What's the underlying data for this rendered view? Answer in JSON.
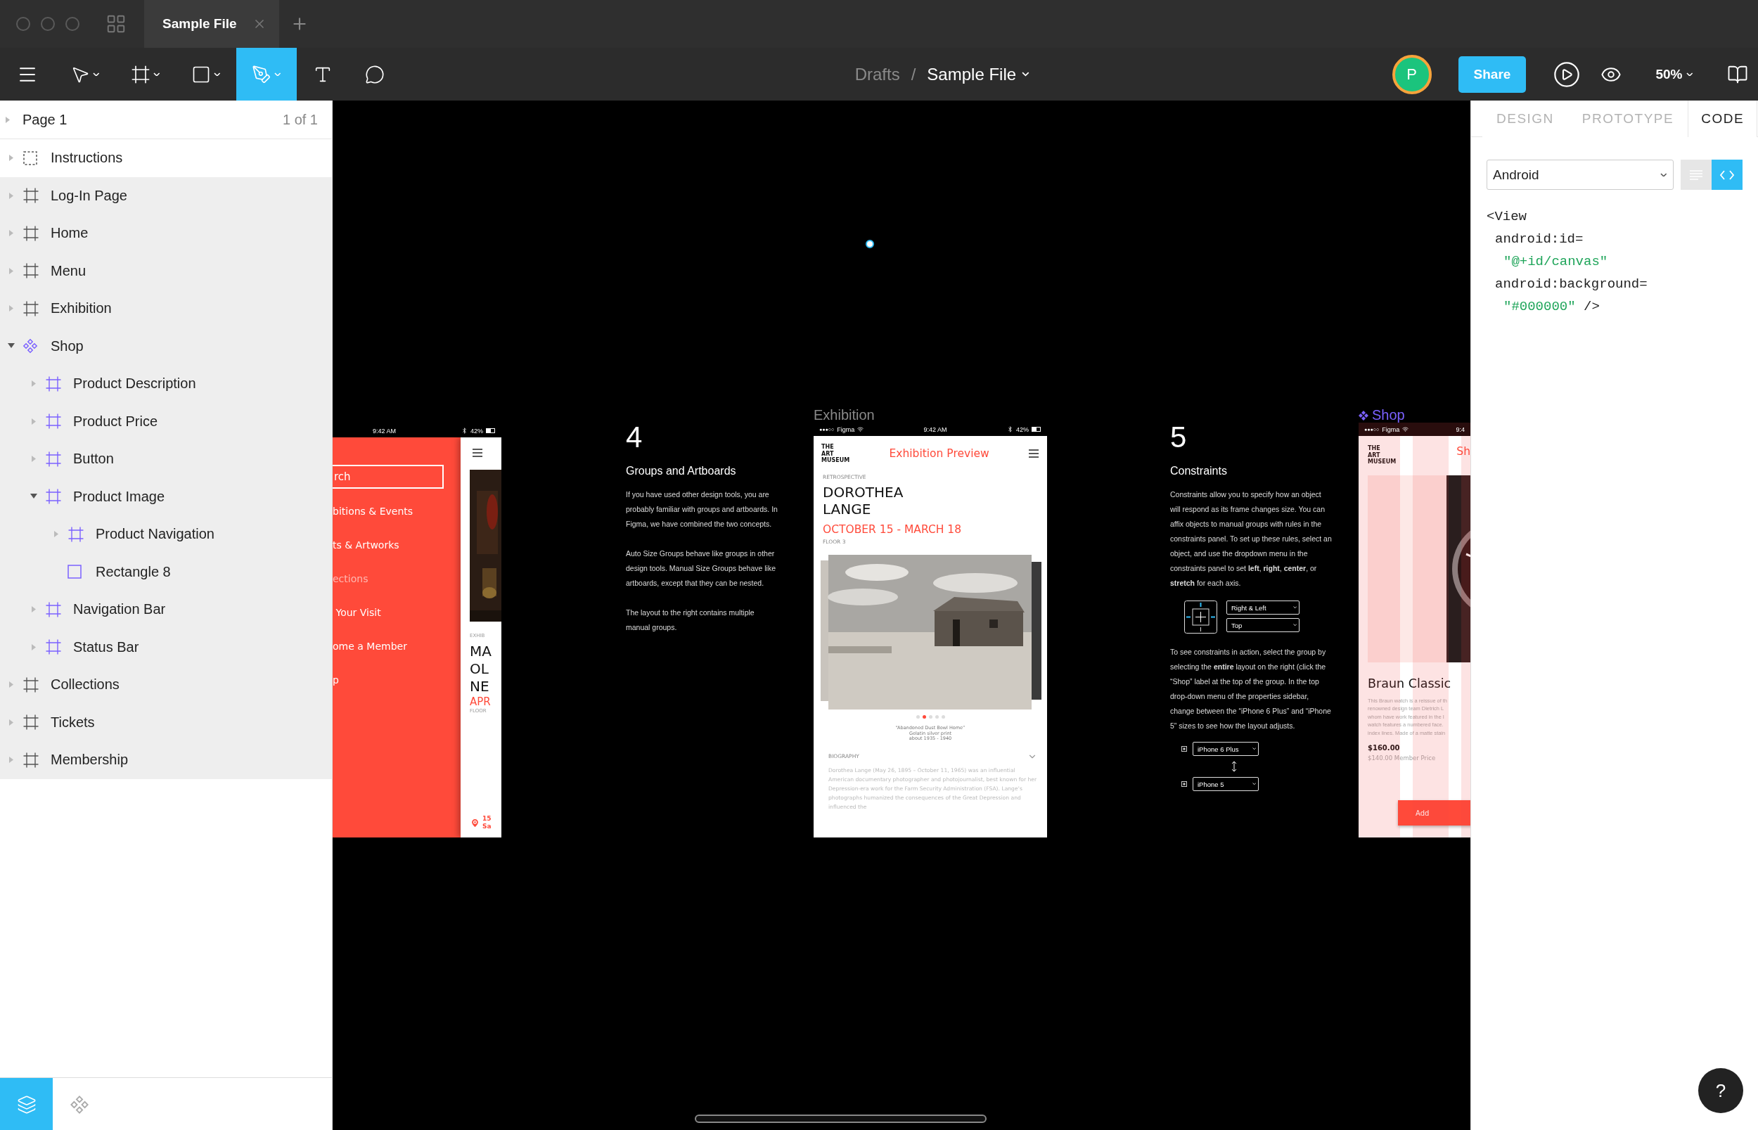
{
  "title_bar": {
    "tabs": [
      {
        "label": "Sample File",
        "selected": true
      }
    ]
  },
  "toolbar": {
    "tools": [
      {
        "kind": "move",
        "selected": false,
        "has_menu": true
      },
      {
        "kind": "frame",
        "selected": false,
        "has_menu": true
      },
      {
        "kind": "shape",
        "selected": false,
        "has_menu": true
      },
      {
        "kind": "pen",
        "selected": true,
        "has_menu": true
      },
      {
        "kind": "text",
        "selected": false,
        "has_menu": false
      },
      {
        "kind": "comment",
        "selected": false,
        "has_menu": false
      }
    ],
    "breadcrumb": {
      "folder": "Drafts",
      "separator": "/",
      "file": "Sample File"
    },
    "avatar": "P",
    "share": "Share",
    "zoom": "50%"
  },
  "layers": {
    "page": {
      "name": "Page 1",
      "count": "1 of 1"
    },
    "items": [
      {
        "name": "Instructions",
        "kind": "group",
        "highlighted": false,
        "expanded": false
      },
      {
        "name": "Log-In Page",
        "kind": "frame",
        "highlighted": true,
        "expanded": false
      },
      {
        "name": "Home",
        "kind": "frame",
        "highlighted": true,
        "expanded": false
      },
      {
        "name": "Menu",
        "kind": "frame",
        "highlighted": true,
        "expanded": false
      },
      {
        "name": "Exhibition",
        "kind": "frame",
        "highlighted": true,
        "expanded": false
      },
      {
        "name": "Shop",
        "kind": "component",
        "highlighted": true,
        "expanded": true,
        "children": [
          {
            "name": "Product Description",
            "kind": "frame",
            "expanded": false
          },
          {
            "name": "Product Price",
            "kind": "frame",
            "expanded": false
          },
          {
            "name": "Button",
            "kind": "frame",
            "expanded": false
          },
          {
            "name": "Product Image",
            "kind": "frame",
            "expanded": true,
            "children": [
              {
                "name": "Product Navigation",
                "kind": "frame",
                "expanded": false
              },
              {
                "name": "Rectangle 8",
                "kind": "rectangle"
              }
            ]
          },
          {
            "name": "Navigation Bar",
            "kind": "frame",
            "expanded": false
          },
          {
            "name": "Status Bar",
            "kind": "frame",
            "expanded": false
          }
        ]
      },
      {
        "name": "Collections",
        "kind": "frame",
        "highlighted": true,
        "expanded": false
      },
      {
        "name": "Tickets",
        "kind": "frame",
        "highlighted": true,
        "expanded": false
      },
      {
        "name": "Membership",
        "kind": "frame",
        "highlighted": true,
        "expanded": false
      }
    ],
    "bottom_tabs": [
      {
        "kind": "layers",
        "selected": true
      },
      {
        "kind": "components",
        "selected": false
      }
    ]
  },
  "canvas": {
    "menu_frame": {
      "time": "9:42 AM",
      "battery": "42%",
      "search": {
        "placeholder": "rch"
      },
      "items": [
        {
          "label": "bitions & Events",
          "dimmed": false
        },
        {
          "label": "ts & Artworks",
          "dimmed": false
        },
        {
          "label": "ections",
          "dimmed": true
        },
        {
          "label": " Your Visit",
          "dimmed": false
        },
        {
          "label": "ome a Member",
          "dimmed": false
        },
        {
          "label": "p",
          "dimmed": false
        }
      ],
      "side": {
        "tag": "EXHIB",
        "title_lines": [
          "MA",
          "OL",
          "NE"
        ],
        "date": "APR",
        "floor": "FLOOR",
        "address_lines": [
          "15",
          "Sa"
        ]
      }
    },
    "groups_note": {
      "number": "4",
      "title": "Groups and Artboards",
      "paragraphs": [
        "If you have used other design tools, you are probably familiar with groups and artboards. In Figma, we have combined the two concepts.",
        "Auto Size Groups behave like groups in other design tools. Manual Size Groups behave like artboards, except that they can be nested.",
        "The layout to the right contains multiple manual groups."
      ]
    },
    "exhibition_frame": {
      "label": "Exhibition",
      "signal": "●●●○○",
      "carrier": "Figma",
      "time": "9:42 AM",
      "battery": "42%",
      "logo": "THE\nART\nMUSEUM",
      "header": "Exhibition Preview",
      "eyebrow": "RETROSPECTIVE",
      "title": "DOROTHEA\nLANGE",
      "dates": "OCTOBER 15 - MARCH 18",
      "floor": "FLOOR 3",
      "slides": [
        {
          "selected": false
        },
        {
          "selected": true
        },
        {
          "selected": false
        },
        {
          "selected": false
        },
        {
          "selected": false
        }
      ],
      "caption": "“Abandoned Dust Bowl Home”\nGelatin silver print\nabout 1935 - 1940",
      "section": "BIOGRAPHY",
      "bio": "Dorothea Lange (May 26, 1895 – October 11, 1965) was an influential American documentary photographer and photojournalist, best known for her Depression-era work for the Farm Security Administration (FSA). Lange’s photographs humanized the consequences of the Great Depression and influenced the"
    },
    "constraints_note": {
      "number": "5",
      "title": "Constraints",
      "intro": "Constraints allow you to specify how an object will respond as its frame changes size. You can affix objects to manual groups with rules in the constraints panel. To set up these rules, select an object, and use the dropdown menu in the constraints panel to set **left**, **right**, **center**, or **stretch** for each axis.",
      "horizontal": "Right & Left",
      "vertical": "Top",
      "outro": "To see constraints in action, select the group by selecting the **entire** layout on the right (click the “Shop” label at the top of the group.  In the top drop-down menu of the properties sidebar, change between the “iPhone 6 Plus” and “iPhone 5” sizes to see how the layout adjusts.",
      "devices": [
        "iPhone 6 Plus",
        "iPhone 5"
      ]
    },
    "shop_frame": {
      "label": "Shop",
      "signal": "●●●○○",
      "carrier": "Figma",
      "time": "9:4",
      "logo": "THE\nART\nMUSEUM",
      "header": "Sh",
      "product": "Braun Classic",
      "description_lines": [
        "This Braun watch is a reissue of th",
        "renowned design team Dietrich L",
        "whom have work featured in the I",
        "watch features a numbered face.",
        "index lines. Made of a matte stain"
      ],
      "price": "$160.00",
      "member_price": "$140.00 Member Price",
      "button": "Add",
      "layout_grid": true
    }
  },
  "inspector": {
    "tabs": [
      {
        "label": "DESIGN",
        "selected": false
      },
      {
        "label": "PROTOTYPE",
        "selected": false
      },
      {
        "label": "CODE",
        "selected": true
      }
    ],
    "platform": "Android",
    "view_modes": [
      {
        "kind": "list",
        "selected": false
      },
      {
        "kind": "code",
        "selected": true
      }
    ],
    "code": [
      {
        "kind": "tag",
        "text": "<View"
      },
      {
        "kind": "attribute",
        "text": "android:id="
      },
      {
        "kind": "value",
        "text": "\"@+id/canvas\""
      },
      {
        "kind": "attribute",
        "text": "android:background="
      },
      {
        "kind": "value",
        "text": "\"#000000\"",
        "tail": " />"
      }
    ]
  },
  "help": "?"
}
